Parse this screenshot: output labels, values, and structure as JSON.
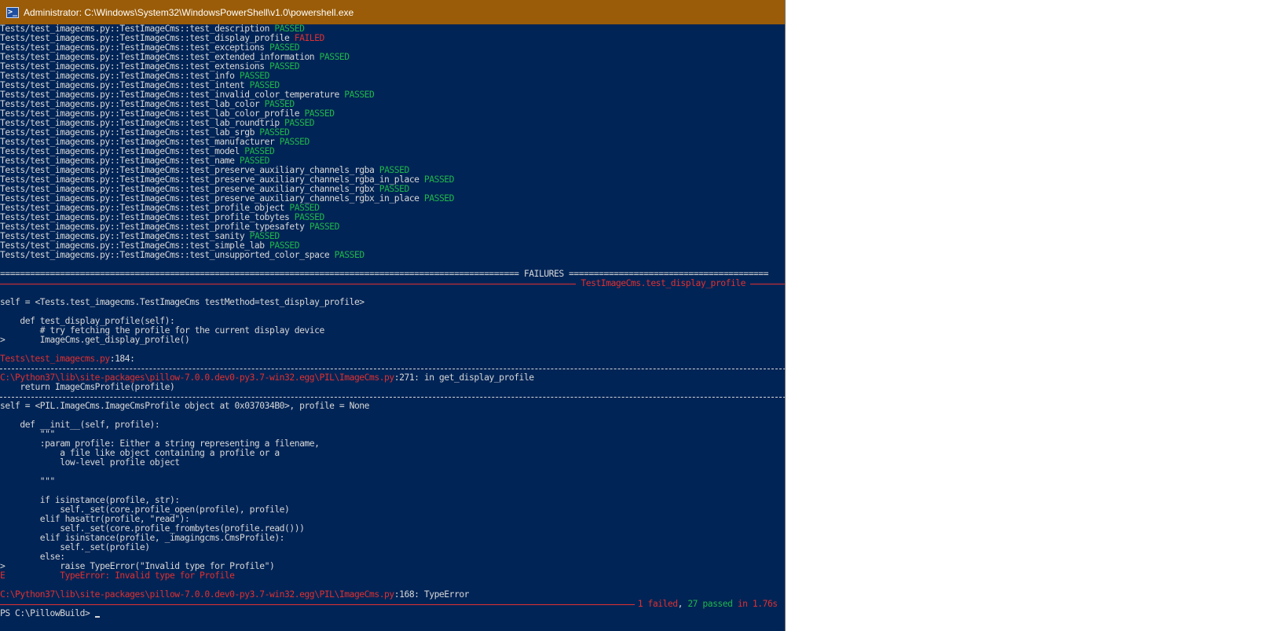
{
  "window": {
    "title": "Administrator: C:\\Windows\\System32\\WindowsPowerShell\\v1.0\\powershell.exe",
    "icon": "powershell-icon",
    "colors": {
      "titlebar": "#9a5c08",
      "console_bg": "#012456",
      "text": "#d8d8d8",
      "failed": "#e03030",
      "passed": "#1fb84a"
    }
  },
  "test_prefix": "Tests/test_imagecms.py::TestImageCms::",
  "tests": [
    {
      "name": "test_description",
      "status": "PASSED"
    },
    {
      "name": "test_display_profile",
      "status": "FAILED"
    },
    {
      "name": "test_exceptions",
      "status": "PASSED"
    },
    {
      "name": "test_extended_information",
      "status": "PASSED"
    },
    {
      "name": "test_extensions",
      "status": "PASSED"
    },
    {
      "name": "test_info",
      "status": "PASSED"
    },
    {
      "name": "test_intent",
      "status": "PASSED"
    },
    {
      "name": "test_invalid_color_temperature",
      "status": "PASSED"
    },
    {
      "name": "test_lab_color",
      "status": "PASSED"
    },
    {
      "name": "test_lab_color_profile",
      "status": "PASSED"
    },
    {
      "name": "test_lab_roundtrip",
      "status": "PASSED"
    },
    {
      "name": "test_lab_srgb",
      "status": "PASSED"
    },
    {
      "name": "test_manufacturer",
      "status": "PASSED"
    },
    {
      "name": "test_model",
      "status": "PASSED"
    },
    {
      "name": "test_name",
      "status": "PASSED"
    },
    {
      "name": "test_preserve_auxiliary_channels_rgba",
      "status": "PASSED"
    },
    {
      "name": "test_preserve_auxiliary_channels_rgba_in_place",
      "status": "PASSED"
    },
    {
      "name": "test_preserve_auxiliary_channels_rgbx",
      "status": "PASSED"
    },
    {
      "name": "test_preserve_auxiliary_channels_rgbx_in_place",
      "status": "PASSED"
    },
    {
      "name": "test_profile_object",
      "status": "PASSED"
    },
    {
      "name": "test_profile_tobytes",
      "status": "PASSED"
    },
    {
      "name": "test_profile_typesafety",
      "status": "PASSED"
    },
    {
      "name": "test_sanity",
      "status": "PASSED"
    },
    {
      "name": "test_simple_lab",
      "status": "PASSED"
    },
    {
      "name": "test_unsupported_color_space",
      "status": "PASSED"
    }
  ],
  "failures_header": "FAILURES",
  "failure_title": "TestImageCms.test_display_profile",
  "traceback1": {
    "self_line": "self = <Tests.test_imagecms.TestImageCms testMethod=test_display_profile>",
    "code": [
      "    def test_display_profile(self):",
      "        # try fetching the profile for the current display device",
      ">       ImageCms.get_display_profile()"
    ],
    "location_file": "Tests\\test_imagecms.py",
    "location_rest": ":184:"
  },
  "traceback2": {
    "location_file": "C:\\Python37\\lib\\site-packages\\pillow-7.0.0.dev0-py3.7-win32.egg\\PIL\\ImageCms.py",
    "location_rest": ":271: in get_display_profile",
    "code": "    return ImageCmsProfile(profile)"
  },
  "traceback3": {
    "self_line": "self = <PIL.ImageCms.ImageCmsProfile object at 0x037034B0>, profile = None",
    "code": [
      "    def __init__(self, profile):",
      "        \"\"\"",
      "        :param profile: Either a string representing a filename,",
      "            a file like object containing a profile or a",
      "            low-level profile object",
      "",
      "        \"\"\"",
      "",
      "        if isinstance(profile, str):",
      "            self._set(core.profile_open(profile), profile)",
      "        elif hasattr(profile, \"read\"):",
      "            self._set(core.profile_frombytes(profile.read()))",
      "        elif isinstance(profile, _imagingcms.CmsProfile):",
      "            self._set(profile)",
      "        else:",
      ">           raise TypeError(\"Invalid type for Profile\")"
    ],
    "error_line": "E           TypeError: Invalid type for Profile",
    "location_file": "C:\\Python37\\lib\\site-packages\\pillow-7.0.0.dev0-py3.7-win32.egg\\PIL\\ImageCms.py",
    "location_rest": ":168: TypeError"
  },
  "summary": {
    "failed": "1 failed",
    "sep": ", ",
    "passed": "27 passed",
    "time": " in 1.76s "
  },
  "prompt": "PS C:\\PillowBuild> "
}
